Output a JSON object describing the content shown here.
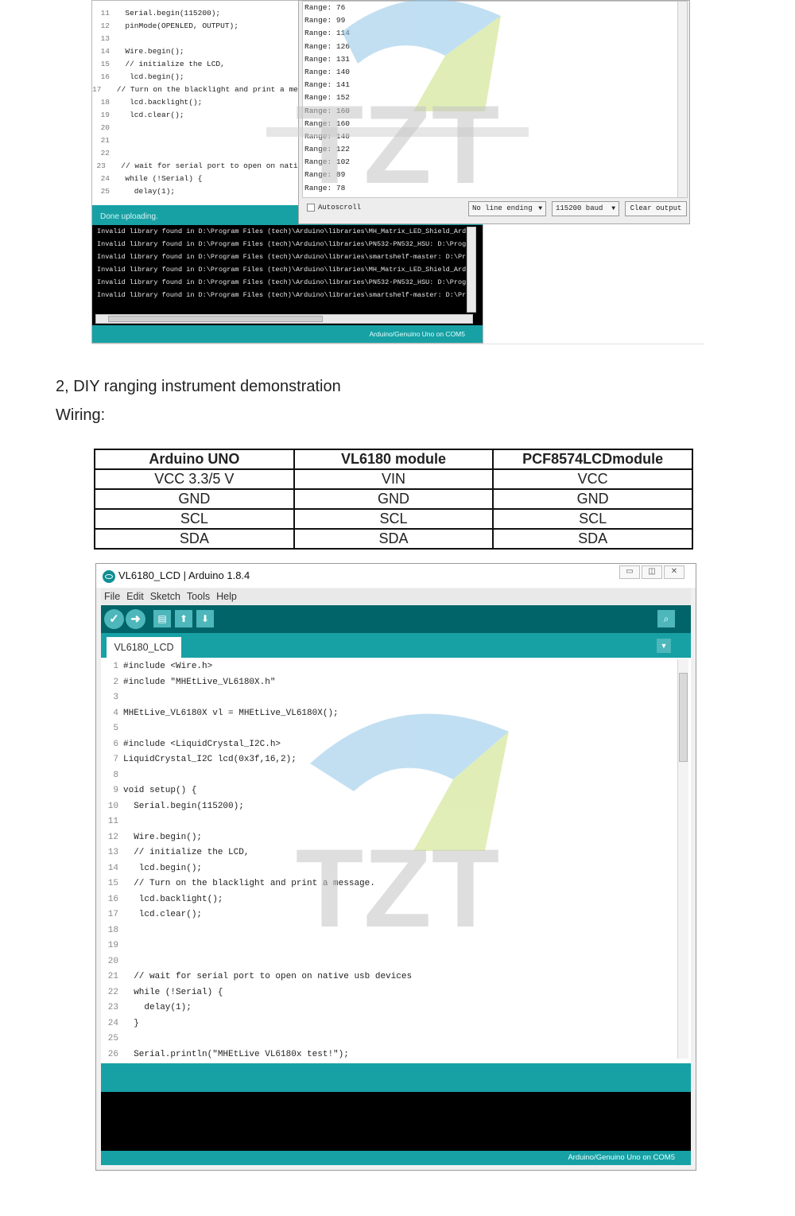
{
  "top_screenshot": {
    "code_lines": [
      {
        "n": "11",
        "text": "  Serial.begin(115200);"
      },
      {
        "n": "12",
        "text": "  pinMode(OPENLED, OUTPUT);"
      },
      {
        "n": "13",
        "text": ""
      },
      {
        "n": "14",
        "text": "  Wire.begin();"
      },
      {
        "n": "15",
        "text": "  // initialize the LCD,"
      },
      {
        "n": "16",
        "text": "   lcd.begin();"
      },
      {
        "n": "17",
        "text": "  // Turn on the blacklight and print a mess"
      },
      {
        "n": "18",
        "text": "   lcd.backlight();"
      },
      {
        "n": "19",
        "text": "   lcd.clear();"
      },
      {
        "n": "20",
        "text": ""
      },
      {
        "n": "21",
        "text": ""
      },
      {
        "n": "22",
        "text": ""
      },
      {
        "n": "23",
        "text": "  // wait for serial port to open on native"
      },
      {
        "n": "24",
        "text": "  while (!Serial) {"
      },
      {
        "n": "25",
        "text": "    delay(1);"
      }
    ],
    "done_uploading": "Done uploading.",
    "console_lines": [
      "Invalid library found in D:\\Program Files (tech)\\Arduino\\libraries\\MH_Matrix_LED_Shield_Ard",
      "Invalid library found in D:\\Program Files (tech)\\Arduino\\libraries\\PN532-PN532_HSU: D:\\Prog",
      "Invalid library found in D:\\Program Files (tech)\\Arduino\\libraries\\smartshelf-master: D:\\Pr",
      "Invalid library found in D:\\Program Files (tech)\\Arduino\\libraries\\MH_Matrix_LED_Shield_Ard",
      "Invalid library found in D:\\Program Files (tech)\\Arduino\\libraries\\PN532-PN532_HSU: D:\\Prog",
      "Invalid library found in D:\\Program Files (tech)\\Arduino\\libraries\\smartshelf-master: D:\\Pr"
    ],
    "status": "Arduino/Genuino Uno on COM5",
    "serial_ranges": [
      "Range: 76",
      "Range: 99",
      "Range: 114",
      "Range: 126",
      "Range: 131",
      "Range: 140",
      "Range: 141",
      "Range: 152",
      "Range: 160",
      "Range: 160",
      "Range: 140",
      "Range: 122",
      "Range: 102",
      "Range: 89",
      "Range: 78"
    ],
    "autoscroll_label": "Autoscroll",
    "line_ending": "No line ending",
    "baud": "115200 baud",
    "clear_output": "Clear output"
  },
  "section_heading": "2, DIY ranging instrument demonstration",
  "wiring_label": "Wiring:",
  "wiring_table": {
    "headers": [
      "Arduino UNO",
      "VL6180 module",
      "PCF8574LCDmodule"
    ],
    "rows": [
      [
        "VCC 3.3/5 V",
        "VIN",
        "VCC"
      ],
      [
        "GND",
        "GND",
        "GND"
      ],
      [
        "SCL",
        "SCL",
        "SCL"
      ],
      [
        "SDA",
        "SDA",
        "SDA"
      ]
    ]
  },
  "ide": {
    "title": "VL6180_LCD | Arduino 1.8.4",
    "menu": [
      "File",
      "Edit",
      "Sketch",
      "Tools",
      "Help"
    ],
    "tab": "VL6180_LCD",
    "code_lines": [
      {
        "n": "1",
        "text": "#include <Wire.h>"
      },
      {
        "n": "2",
        "text": "#include \"MHEtLive_VL6180X.h\""
      },
      {
        "n": "3",
        "text": ""
      },
      {
        "n": "4",
        "text": "MHEtLive_VL6180X vl = MHEtLive_VL6180X();"
      },
      {
        "n": "5",
        "text": ""
      },
      {
        "n": "6",
        "text": "#include <LiquidCrystal_I2C.h>"
      },
      {
        "n": "7",
        "text": "LiquidCrystal_I2C lcd(0x3f,16,2);"
      },
      {
        "n": "8",
        "text": ""
      },
      {
        "n": "9",
        "text": "void setup() {"
      },
      {
        "n": "10",
        "text": "  Serial.begin(115200);"
      },
      {
        "n": "11",
        "text": ""
      },
      {
        "n": "12",
        "text": "  Wire.begin();"
      },
      {
        "n": "13",
        "text": "  // initialize the LCD,"
      },
      {
        "n": "14",
        "text": "   lcd.begin();"
      },
      {
        "n": "15",
        "text": "  // Turn on the blacklight and print a message."
      },
      {
        "n": "16",
        "text": "   lcd.backlight();"
      },
      {
        "n": "17",
        "text": "   lcd.clear();"
      },
      {
        "n": "18",
        "text": ""
      },
      {
        "n": "19",
        "text": ""
      },
      {
        "n": "20",
        "text": ""
      },
      {
        "n": "21",
        "text": "  // wait for serial port to open on native usb devices"
      },
      {
        "n": "22",
        "text": "  while (!Serial) {"
      },
      {
        "n": "23",
        "text": "    delay(1);"
      },
      {
        "n": "24",
        "text": "  }"
      },
      {
        "n": "25",
        "text": ""
      },
      {
        "n": "26",
        "text": "  Serial.println(\"MHEtLive VL6180x test!\");"
      }
    ],
    "status": "Arduino/Genuino Uno on COM5"
  },
  "watermark_text": "TZT",
  "colors": {
    "teal": "#17a1a5",
    "dark_teal": "#006468",
    "button_teal": "#4db7bb"
  }
}
